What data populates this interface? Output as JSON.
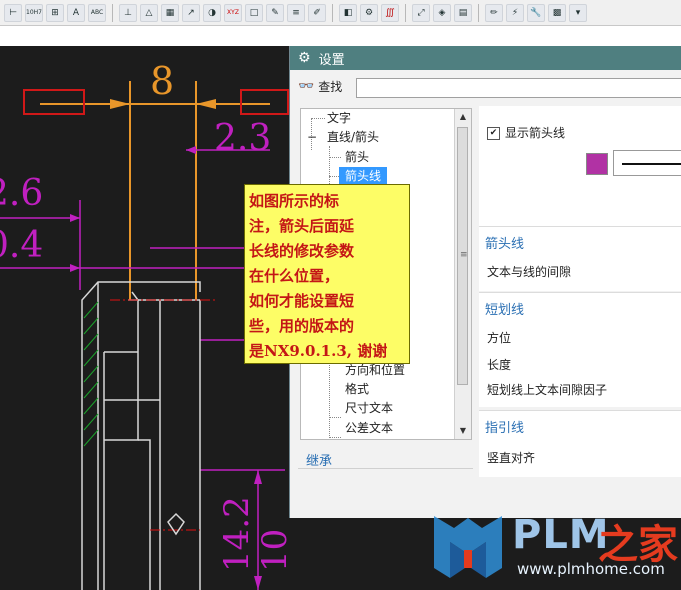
{
  "toolbar": {
    "icons": [
      "dimension-icon",
      "tolerance-icon",
      "datum-icon",
      "text-icon",
      "abc-icon",
      "datum-feature-icon",
      "triangle-icon",
      "table-icon",
      "arrow-a-icon",
      "circle-icon",
      "xyz-icon",
      "rectangle-icon",
      "note-icon",
      "list-icon",
      "edit-icon",
      "layer-icon",
      "gear-icon",
      "style-icon",
      "expand-icon",
      "layers-icon",
      "stack-icon",
      "pencil-icon",
      "bolt-icon",
      "wrench-icon",
      "grid-icon",
      "drop-icon"
    ],
    "labels": {
      "tolerance": "10H7",
      "abc": "ABC",
      "xyz": "XYZ"
    }
  },
  "dialog": {
    "title": "设置",
    "search_label": "查找",
    "search_value": "",
    "tree": {
      "items": [
        {
          "label": "文字",
          "level": 0
        },
        {
          "label": "直线/箭头",
          "level": 0,
          "expander": "−"
        },
        {
          "label": "箭头",
          "level": 1
        },
        {
          "label": "箭头线",
          "level": 1,
          "selected": true
        },
        {
          "label": "方向和位置",
          "level": 1
        },
        {
          "label": "格式",
          "level": 1
        },
        {
          "label": "尺寸文本",
          "level": 1
        },
        {
          "label": "公差文本",
          "level": 1
        }
      ]
    },
    "inherit_label": "继承",
    "panel": {
      "show_arrow_line_label": "显示箭头线",
      "show_arrow_line_checked": true,
      "line_color": "#b132a4",
      "sections": [
        {
          "title": "箭头线",
          "fields": [
            "文本与线的间隙"
          ]
        },
        {
          "title": "短划线",
          "fields": [
            "方位",
            "长度",
            "短划线上文本间隙因子"
          ]
        },
        {
          "title": "指引线",
          "fields": [
            "竖直对齐"
          ]
        }
      ]
    }
  },
  "callout": {
    "lines": [
      "如图所示的标",
      "注，箭头后面延",
      "长线的修改参数",
      "在什么位置，",
      "如何才能设置短",
      "些，用的版本的",
      "是NX9.0.1.3, 谢谢"
    ]
  },
  "drawing": {
    "dims": [
      "8",
      "2.3",
      "2.6",
      "0.4",
      "14.2",
      "10"
    ],
    "colors": {
      "dimension": "#c020c0",
      "highlight": "#e8962a",
      "red": "#e01010",
      "green": "#1aa02a"
    }
  },
  "watermark": {
    "brand": "PLM",
    "brand_cn": "之家",
    "url": "www.plmhome.com"
  }
}
